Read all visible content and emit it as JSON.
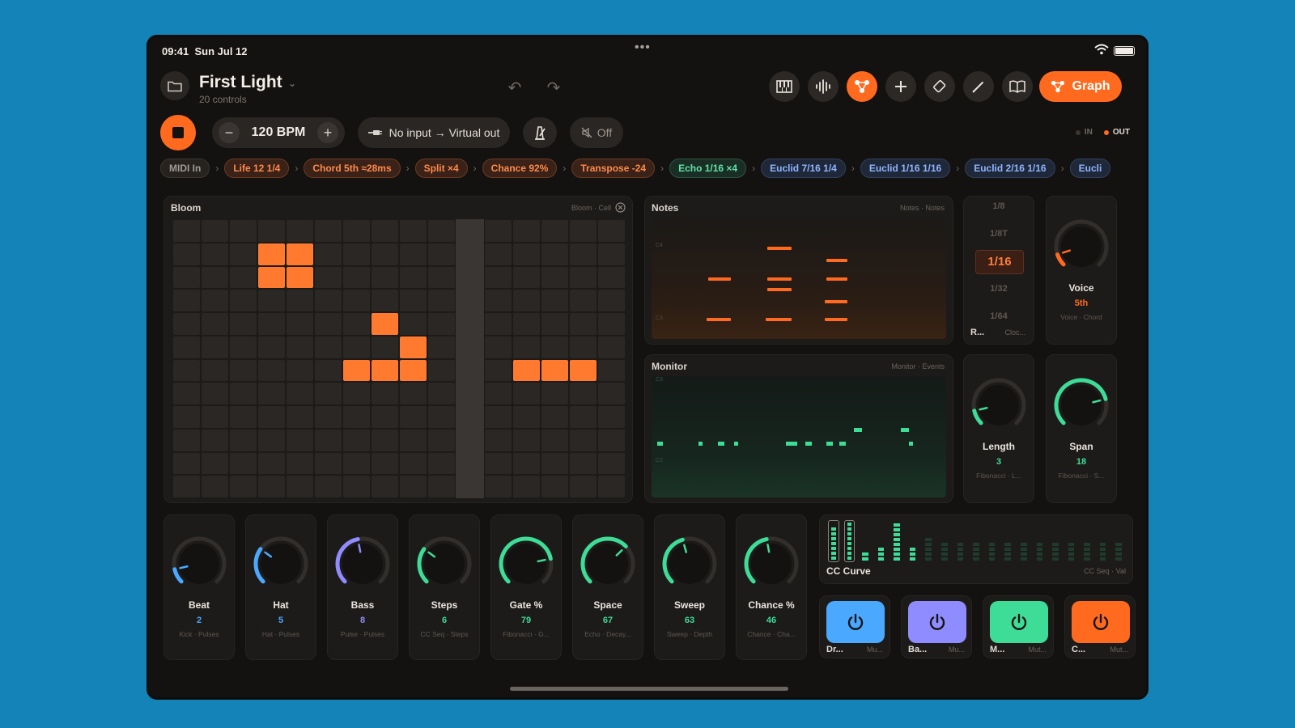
{
  "status_bar": {
    "time": "09:41",
    "date": "Sun Jul 12",
    "dots": "•••"
  },
  "project": {
    "title": "First Light",
    "subtitle": "20 controls"
  },
  "toolbar": {
    "buttons": [
      "piano-icon",
      "waveform-icon",
      "graph-nodes-icon",
      "plus-icon",
      "eraser-icon",
      "pencil-icon",
      "book-icon"
    ],
    "active_button": "graph-nodes-icon",
    "graph_label": "Graph"
  },
  "transport": {
    "bpm_label": "120 BPM",
    "minus": "−",
    "plus": "+",
    "routing": "No input → Virtual out",
    "mute_label": "Off",
    "in_label": "IN",
    "out_label": "OUT"
  },
  "chain": [
    {
      "label": "MIDI In",
      "style": "grey"
    },
    {
      "label": "Life 12 1/4",
      "style": "orange"
    },
    {
      "label": "Chord 5th ≈28ms",
      "style": "orange"
    },
    {
      "label": "Split ×4",
      "style": "orange"
    },
    {
      "label": "Chance 92%",
      "style": "orange"
    },
    {
      "label": "Transpose -24",
      "style": "orange"
    },
    {
      "label": "Echo 1/16 ×4",
      "style": "green"
    },
    {
      "label": "Euclid 7/16 1/4",
      "style": "blue"
    },
    {
      "label": "Euclid 1/16 1/16",
      "style": "blue"
    },
    {
      "label": "Euclid 2/16 1/16",
      "style": "blue"
    },
    {
      "label": "Eucli",
      "style": "blue"
    }
  ],
  "bloom": {
    "title": "Bloom",
    "meta": "Bloom · Cell",
    "cols": 16,
    "rows": 12,
    "playhead_col": 10,
    "active_cells": [
      [
        3,
        1
      ],
      [
        4,
        1
      ],
      [
        3,
        2
      ],
      [
        4,
        2
      ],
      [
        7,
        4
      ],
      [
        8,
        5
      ],
      [
        6,
        6
      ],
      [
        7,
        6
      ],
      [
        8,
        6
      ],
      [
        12,
        6
      ],
      [
        13,
        6
      ],
      [
        14,
        6
      ]
    ]
  },
  "notes_panel": {
    "title": "Notes",
    "meta": "Notes · Notes",
    "top_label": "C4",
    "bottom_label": "C3"
  },
  "monitor_panel": {
    "title": "Monitor",
    "meta": "Monitor · Events",
    "top_label": "C3",
    "bottom_label": "C2"
  },
  "rate_picker": {
    "options": [
      "1/8",
      "1/8T",
      "1/16",
      "1/32",
      "1/64"
    ],
    "selected": "1/16",
    "label": "R...",
    "meta": "Cloc..."
  },
  "side_knobs": [
    {
      "name": "Voice",
      "value": "5th",
      "sub": "Voice · Chord",
      "color": "#ff6a1f",
      "level": 0.1
    },
    {
      "name": "Length",
      "value": "3",
      "sub": "Fibonacci · L...",
      "color": "#3ddc97",
      "level": 0.12
    },
    {
      "name": "Span",
      "value": "18",
      "sub": "Fibonacci · S...",
      "color": "#3ddc97",
      "level": 0.78
    }
  ],
  "knobs": [
    {
      "name": "Beat",
      "value": "2",
      "sub": "Kick · Pulses",
      "color": "#4aa8ff",
      "level": 0.12
    },
    {
      "name": "Hat",
      "value": "5",
      "sub": "Hat · Pulses",
      "color": "#4aa8ff",
      "level": 0.3
    },
    {
      "name": "Bass",
      "value": "8",
      "sub": "Pulse · Pulses",
      "color": "#8f8cff",
      "level": 0.46
    },
    {
      "name": "Steps",
      "value": "6",
      "sub": "CC Seq · Steps",
      "color": "#3ddc97",
      "level": 0.3
    },
    {
      "name": "Gate %",
      "value": "79",
      "sub": "Fibonacci · G...",
      "color": "#3ddc97",
      "level": 0.79
    },
    {
      "name": "Space",
      "value": "67",
      "sub": "Echo · Decay...",
      "color": "#3ddc97",
      "level": 0.67
    },
    {
      "name": "Sweep",
      "value": "63",
      "sub": "Sweep · Depth",
      "color": "#3ddc97",
      "level": 0.44
    },
    {
      "name": "Chance %",
      "value": "46",
      "sub": "Chance · Cha...",
      "color": "#3ddc97",
      "level": 0.46
    }
  ],
  "cc_curve": {
    "label": "CC Curve",
    "meta": "CC Seq · Val",
    "bars": [
      0.8,
      0.95,
      0.2,
      0.35,
      0.95,
      0.3,
      0.6,
      0.45,
      0.45,
      0.45,
      0.45,
      0.45,
      0.45,
      0.45,
      0.45,
      0.45,
      0.45,
      0.45,
      0.45
    ],
    "active_count": 6
  },
  "mute_buttons": [
    {
      "label": "Dr...",
      "meta": "Mu...",
      "color": "#4aa8ff"
    },
    {
      "label": "Ba...",
      "meta": "Mu...",
      "color": "#8f8cff"
    },
    {
      "label": "M...",
      "meta": "Mut...",
      "color": "#3ddc97"
    },
    {
      "label": "C...",
      "meta": "Mut...",
      "color": "#ff6a1f"
    }
  ]
}
